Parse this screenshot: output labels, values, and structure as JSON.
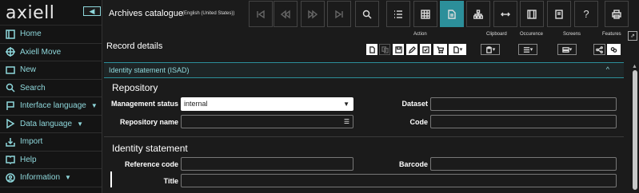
{
  "sidebar": {
    "logo": "axiell",
    "collapse_glyph": "◀",
    "items": [
      {
        "label": "Home",
        "icon": "home-icon",
        "has_caret": false
      },
      {
        "label": "Axiell Move",
        "icon": "move-icon",
        "has_caret": false
      },
      {
        "label": "New",
        "icon": "new-icon",
        "has_caret": false
      },
      {
        "label": "Search",
        "icon": "search-icon",
        "has_caret": false
      },
      {
        "label": "Interface language",
        "icon": "flag-icon",
        "has_caret": true
      },
      {
        "label": "Data language",
        "icon": "play-icon",
        "has_caret": true
      },
      {
        "label": "Import",
        "icon": "import-icon",
        "has_caret": false
      },
      {
        "label": "Help",
        "icon": "book-icon",
        "has_caret": false
      },
      {
        "label": "Information",
        "icon": "info-icon",
        "has_caret": true
      }
    ]
  },
  "topbar": {
    "title": "Archives catalogue",
    "language": "(English (United States))",
    "help_glyph": "?"
  },
  "subheader": {
    "title": "Record details",
    "groups": {
      "action": "Action",
      "clipboard": "Clipboard",
      "occurrence": "Occurence",
      "screens": "Screens",
      "features": "Features"
    }
  },
  "section": {
    "title": "Identity statement (ISAD)",
    "chevron": "^"
  },
  "repository": {
    "heading": "Repository",
    "management_status_label": "Management status",
    "management_status_value": "internal",
    "repository_name_label": "Repository name",
    "repository_name_value": "",
    "dataset_label": "Dataset",
    "dataset_value": "",
    "code_label": "Code",
    "code_value": ""
  },
  "identity": {
    "heading": "Identity statement",
    "reference_code_label": "Reference code",
    "reference_code_value": "",
    "barcode_label": "Barcode",
    "barcode_value": "",
    "title_label": "Title",
    "title_value": ""
  },
  "colors": {
    "accent": "#2c8f9a",
    "accent_text": "#8fd8dc",
    "background": "#1b1b1b"
  }
}
